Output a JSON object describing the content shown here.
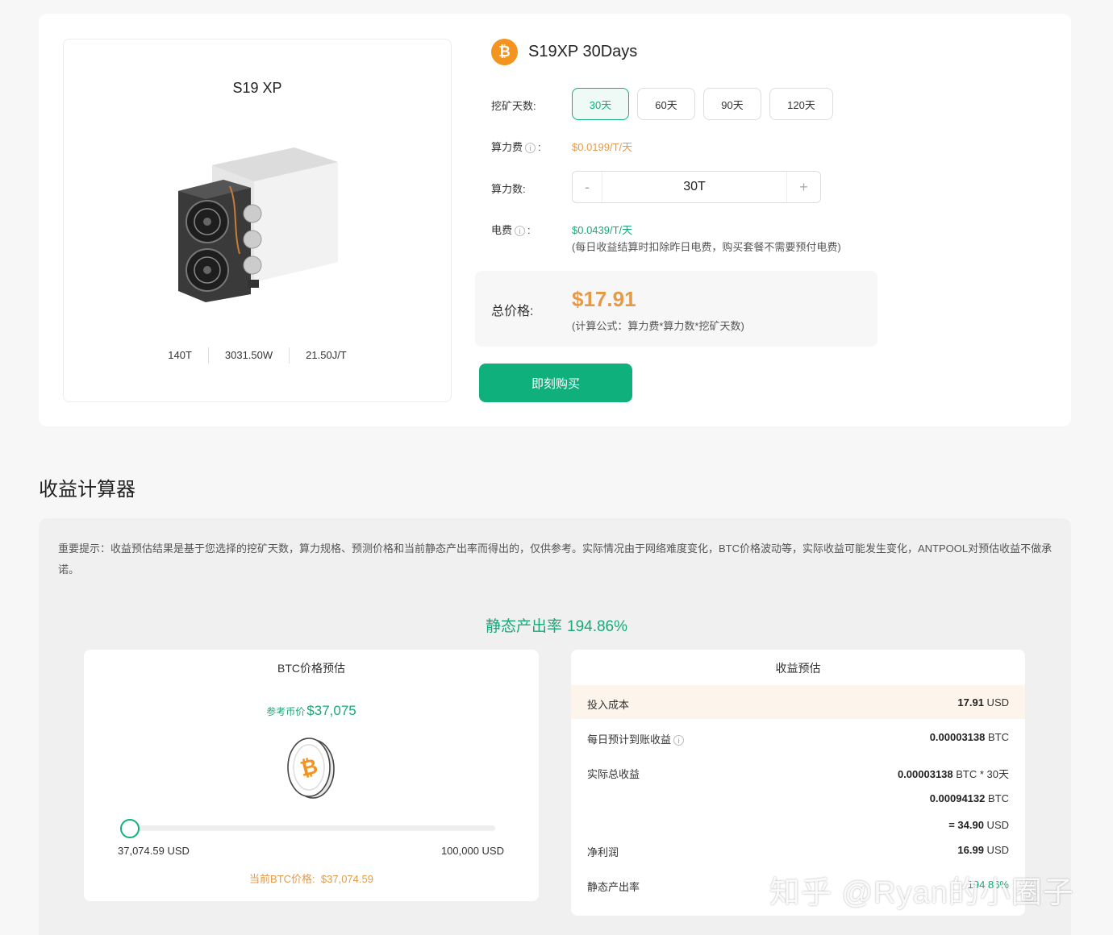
{
  "product": {
    "name": "S19 XP",
    "specs": [
      "140T",
      "3031.50W",
      "21.50J/T"
    ],
    "title": "S19XP 30Days",
    "coin_icon": "bitcoin-icon"
  },
  "purchase": {
    "days_label": "挖矿天数:",
    "days_options": [
      "30天",
      "60天",
      "90天",
      "120天"
    ],
    "selected_day": "30天",
    "hashrate_fee_label": "算力费",
    "hashrate_fee_colon": ":",
    "hashrate_fee_value": "$0.0199/T/天",
    "hashrate_label": "算力数:",
    "hashrate_minus": "-",
    "hashrate_value": "30T",
    "hashrate_plus": "+",
    "elec_label": "电费",
    "elec_colon": ":",
    "elec_value": "$0.0439/T/天",
    "elec_note": "(每日收益结算时扣除昨日电费，购买套餐不需要预付电费)",
    "total_label": "总价格:",
    "total_value": "$17.91",
    "total_formula": "(计算公式：算力费*算力数*挖矿天数)",
    "buy_label": "即刻购买"
  },
  "calculator": {
    "heading": "收益计算器",
    "notice": "重要提示：收益预估结果是基于您选择的挖矿天数，算力规格、预测价格和当前静态产出率而得出的，仅供参考。实际情况由于网络难度变化，BTC价格波动等，实际收益可能发生变化，ANTPOOL对预估收益不做承诺。",
    "static_rate_label": "静态产出率",
    "static_rate_value": "194.86%",
    "btc_panel": {
      "title": "BTC价格预估",
      "ref_label": "参考币价",
      "ref_value": "$37,075",
      "slider_value_fraction": 0.0,
      "slider_min": "37,074.59 USD",
      "slider_max": "100,000 USD",
      "current_label": "当前BTC价格:",
      "current_value": "$37,074.59"
    },
    "earn_panel": {
      "title": "收益预估",
      "cost_label": "投入成本",
      "cost_value": "17.91",
      "cost_unit": " USD",
      "daily_label": "每日预计到账收益",
      "daily_value": "0.00003138",
      "daily_unit": " BTC",
      "total_label": "实际总收益",
      "total_value": "0.00003138",
      "total_unit": " BTC * 30天",
      "total_btc": "0.00094132",
      "total_btc_unit": " BTC",
      "total_usd": "= 34.90",
      "total_usd_unit": " USD",
      "net_label": "净利润",
      "net_value": "16.99",
      "net_unit": " USD",
      "rate_label": "静态产出率",
      "rate_value": "194.86%"
    }
  },
  "watermark": "知乎 @Ryan的小圈子",
  "colors": {
    "accent": "#0fb07c",
    "price": "#e59a4a",
    "btc": "#f39320"
  }
}
